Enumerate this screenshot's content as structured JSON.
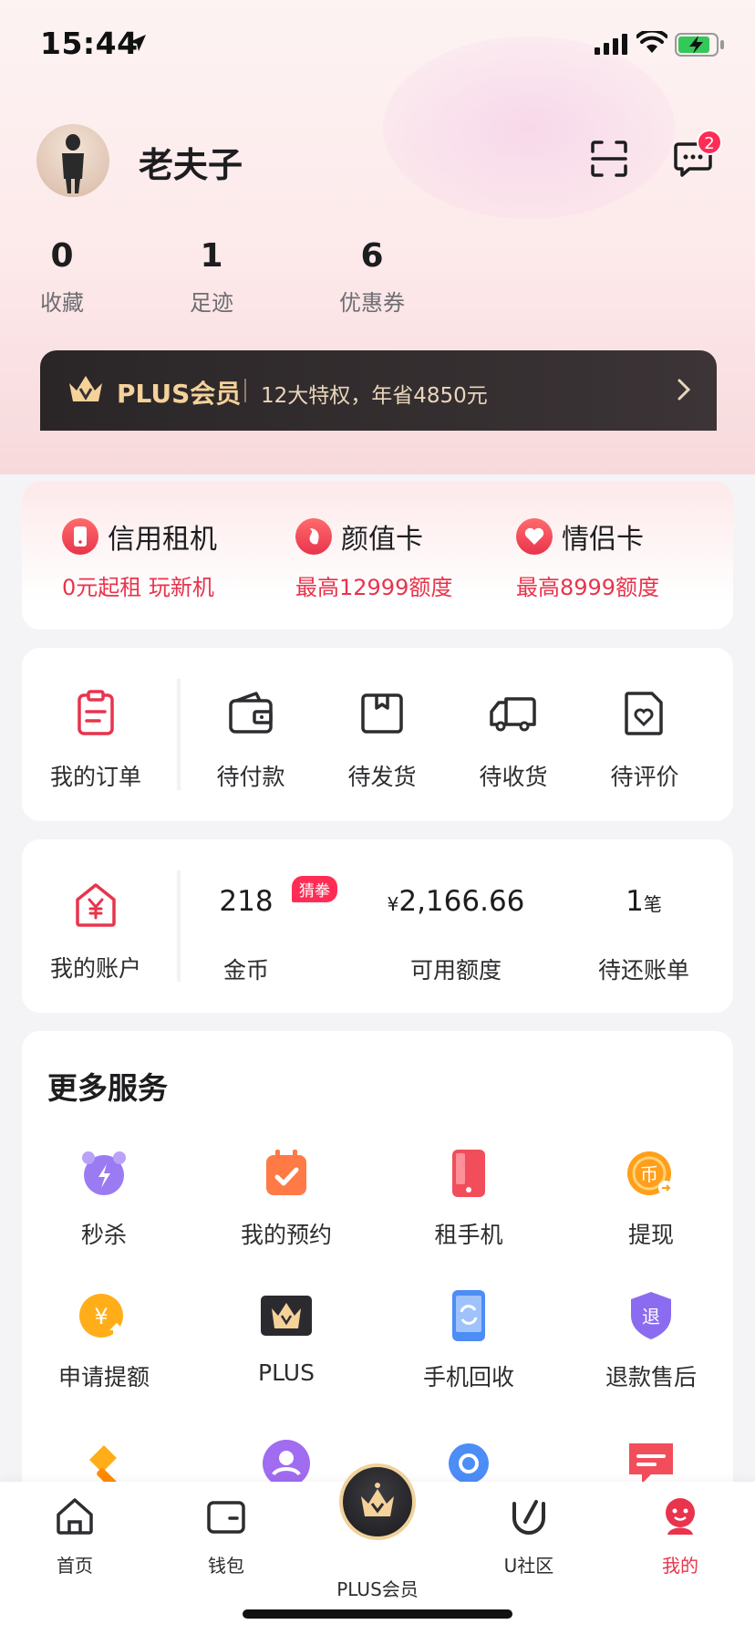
{
  "status_bar": {
    "time": "15:44"
  },
  "profile": {
    "name": "老夫子",
    "message_badge": "2"
  },
  "stats": [
    {
      "value": "0",
      "label": "收藏"
    },
    {
      "value": "1",
      "label": "足迹"
    },
    {
      "value": "6",
      "label": "优惠券"
    }
  ],
  "plus_banner": {
    "title": "PLUS会员",
    "subtitle": "12大特权，年省4850元"
  },
  "quota_cards": [
    {
      "title": "信用租机",
      "sub": "0元起租 玩新机"
    },
    {
      "title": "颜值卡",
      "sub": "最高12999额度"
    },
    {
      "title": "情侣卡",
      "sub": "最高8999额度"
    }
  ],
  "orders": {
    "main_label": "我的订单",
    "items": [
      "待付款",
      "待发货",
      "待收货",
      "待评价"
    ]
  },
  "account": {
    "main_label": "我的账户",
    "coins_value": "218",
    "coins_tag": "猜拳",
    "coins_label": "金币",
    "credit_currency": "¥",
    "credit_value": "2,166.66",
    "credit_label": "可用额度",
    "bills_value": "1",
    "bills_unit": "笔",
    "bills_label": "待还账单"
  },
  "services": {
    "title": "更多服务",
    "items": [
      "秒杀",
      "我的预约",
      "租手机",
      "提现",
      "申请提额",
      "PLUS",
      "手机回收",
      "退款售后"
    ]
  },
  "tabbar": {
    "items": [
      "首页",
      "钱包",
      "PLUS会员",
      "U社区",
      "我的"
    ],
    "active": "我的"
  },
  "colors": {
    "accent": "#e8344d",
    "badge": "#ff2d55",
    "plus_gold": "#f4d29a"
  }
}
